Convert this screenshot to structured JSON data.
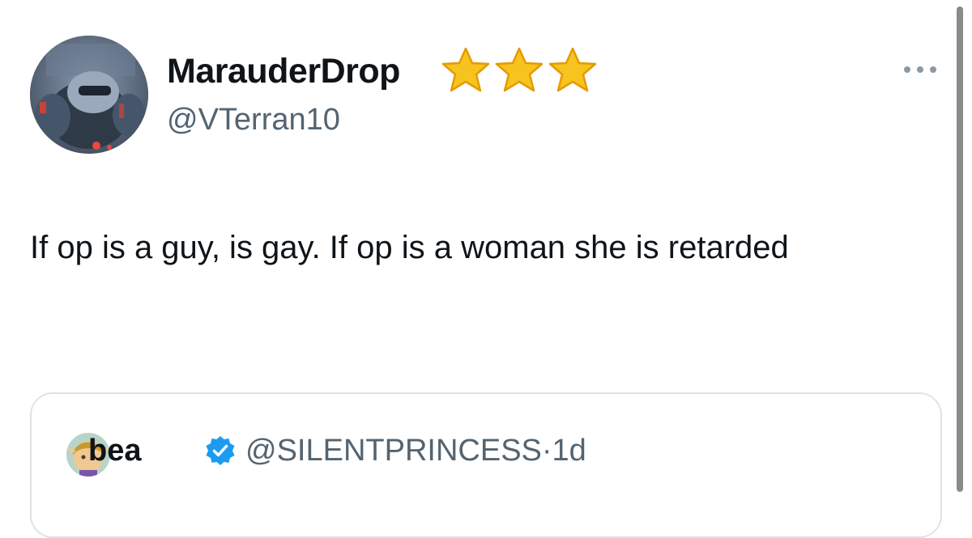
{
  "tweet": {
    "author": {
      "display_name": "MarauderDrop",
      "handle": "@VTerran10",
      "badges": [
        "star-icon",
        "star-icon",
        "star-icon"
      ]
    },
    "text": "If op is a guy, is gay. If op is a woman she is retarded",
    "more_icon": "more-horizontal-icon"
  },
  "quoted_tweet": {
    "display_name": "bea",
    "verified_icon": "verified-badge-icon",
    "handle": "@SILENTPRINCESS",
    "separator": "·",
    "time": "1d"
  },
  "colors": {
    "text_primary": "#0f1419",
    "text_secondary": "#536471",
    "verified_blue": "#1d9bf0",
    "star_gold": "#f7b500",
    "border": "#dde3e8"
  }
}
